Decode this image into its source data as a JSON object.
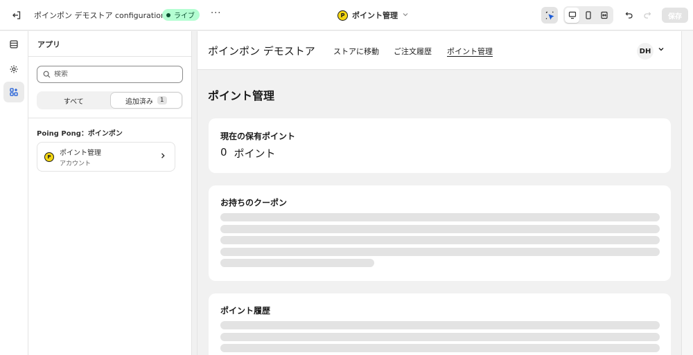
{
  "topbar": {
    "title": "ポインポン デモストア configuration",
    "status_badge": "ライブ",
    "more_label": "···",
    "center_app_name": "ポイント管理",
    "logo_letter": "P",
    "save_label": "保存"
  },
  "panel": {
    "title": "アプリ",
    "search_placeholder": "検索",
    "segments": {
      "all": "すべて",
      "added": "追加済み",
      "added_count": "1"
    },
    "group_title": "Poing Pong：ポインポン",
    "app_item": {
      "name": "ポイント管理",
      "sub": "アカウント"
    }
  },
  "store": {
    "name": "ポインポン デモストア",
    "nav": [
      "ストアに移動",
      "ご注文履歴",
      "ポイント管理"
    ],
    "current_nav": "ポイント管理",
    "avatar": "DH",
    "page_title": "ポイント管理",
    "points_card": {
      "title": "現在の保有ポイント",
      "value": "0",
      "unit": "ポイント"
    },
    "coupons_card": {
      "title": "お持ちのクーポン"
    },
    "history_card": {
      "title": "ポイント履歴"
    }
  },
  "colors": {
    "live_badge_bg": "#b4fed2",
    "logo_yellow": "#f2d513",
    "skeleton": "#e3e3e3"
  },
  "icons": [
    "exit-icon",
    "chevron-down-icon",
    "inspector-icon",
    "desktop-icon",
    "mobile-icon",
    "fullwidth-icon",
    "undo-icon",
    "redo-icon",
    "sections-icon",
    "settings-icon",
    "apps-icon",
    "search-icon",
    "chevron-right-icon"
  ]
}
